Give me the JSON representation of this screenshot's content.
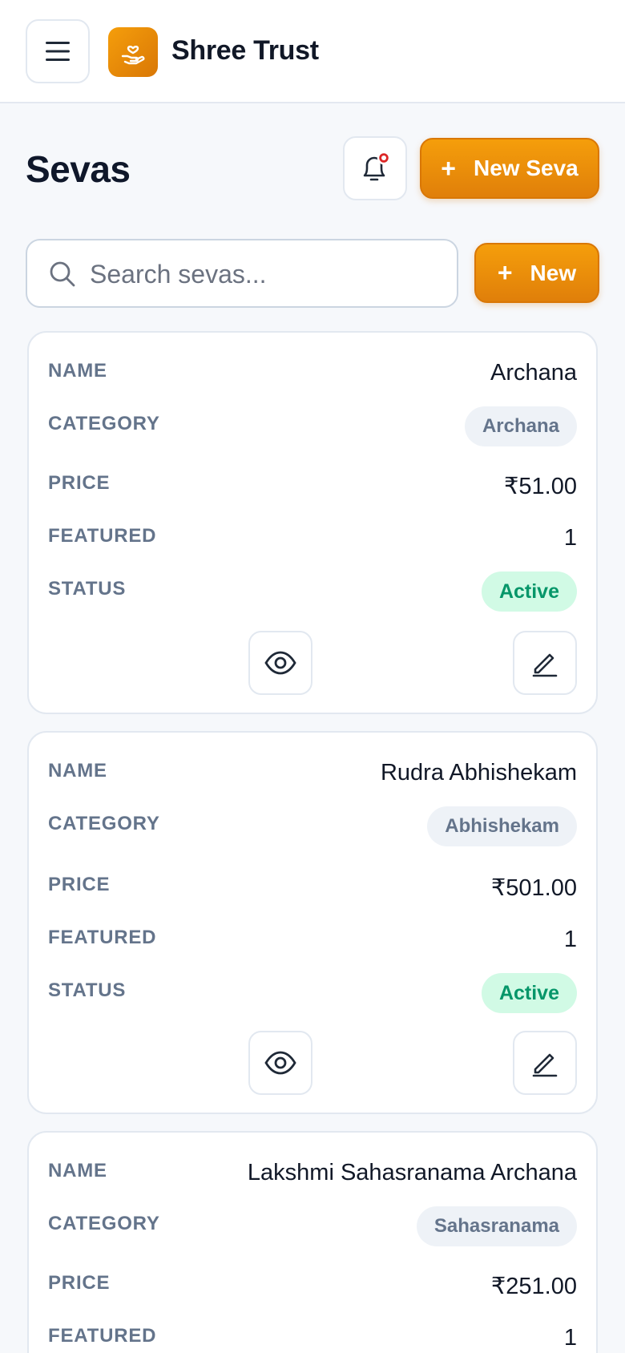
{
  "header": {
    "brand": "Shree Trust",
    "menu_icon": "hamburger-icon",
    "logo_icon": "hand-heart-icon"
  },
  "page": {
    "title": "Sevas",
    "notification_icon": "bell-icon",
    "new_seva_label": "New Seva",
    "new_label": "New",
    "plus_glyph": "+"
  },
  "search": {
    "placeholder": "Search sevas..."
  },
  "labels": {
    "name": "NAME",
    "category": "CATEGORY",
    "price": "PRICE",
    "featured": "FEATURED",
    "status": "STATUS"
  },
  "sevas": [
    {
      "name": "Archana",
      "category": "Archana",
      "price": "₹51.00",
      "featured": "1",
      "status": "Active"
    },
    {
      "name": "Rudra Abhishekam",
      "category": "Abhishekam",
      "price": "₹501.00",
      "featured": "1",
      "status": "Active"
    },
    {
      "name": "Lakshmi Sahasranama Archana",
      "category": "Sahasranama",
      "price": "₹251.00",
      "featured": "1",
      "status": ""
    }
  ],
  "colors": {
    "accent": "#f59e0b",
    "accent_dark": "#d97706",
    "active_bg": "#d1fae5",
    "active_text": "#059669"
  }
}
